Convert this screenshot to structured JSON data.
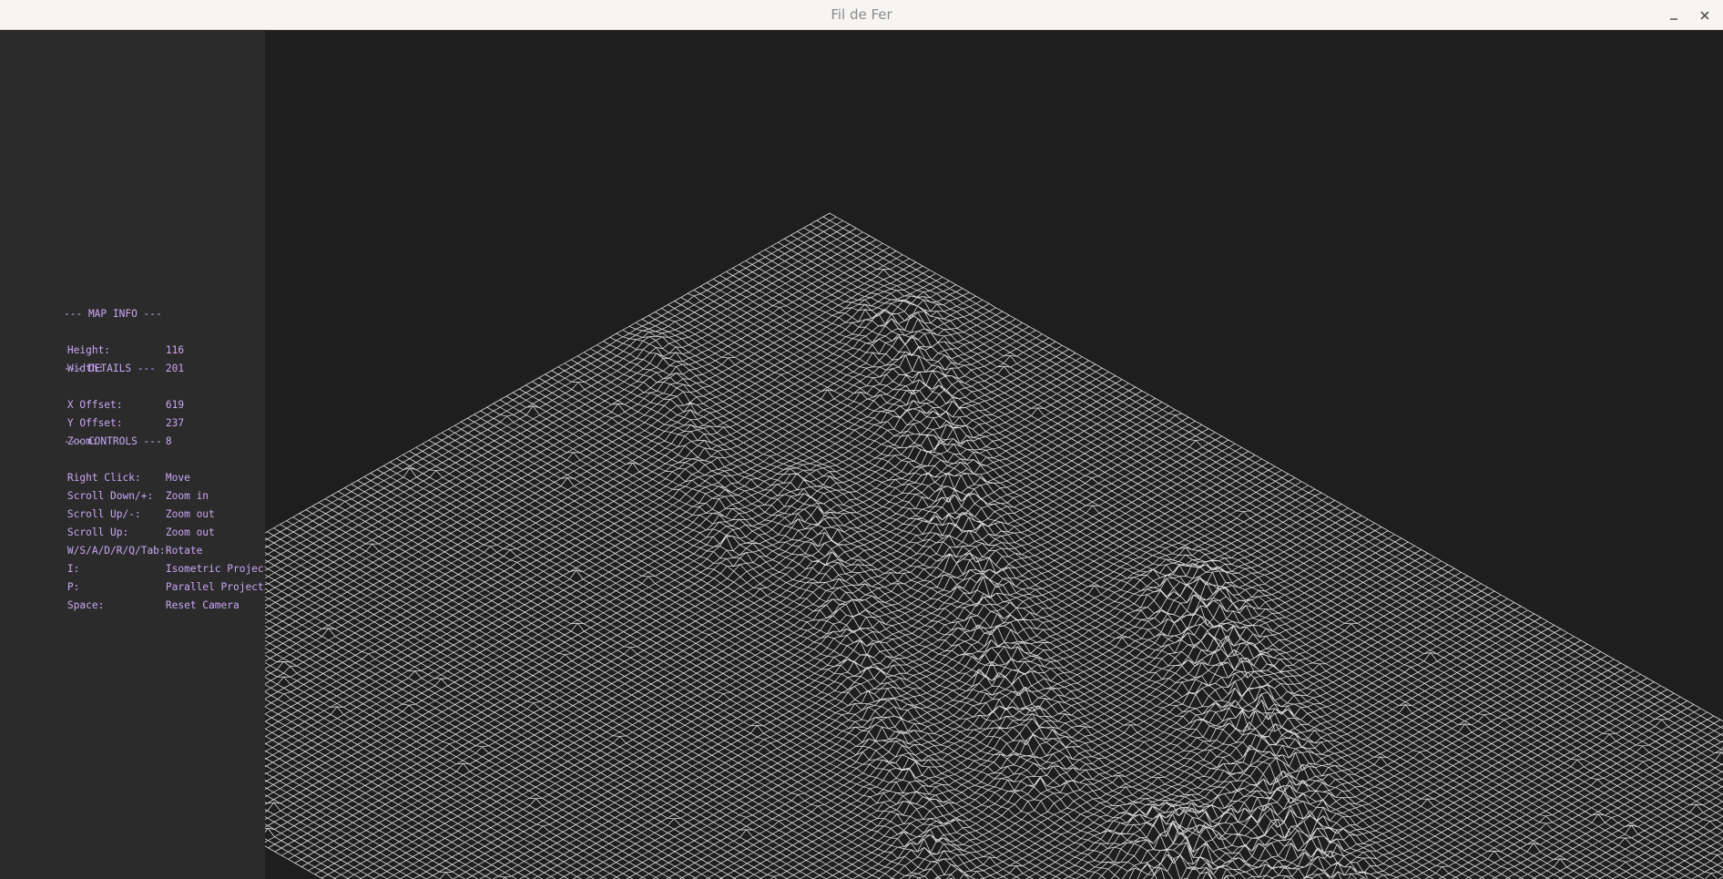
{
  "window": {
    "title": "Fil de Fer",
    "minimize_icon": "minimize-icon",
    "close_icon": "close-icon"
  },
  "info": {
    "map_info_heading": "--- MAP INFO ---",
    "height_label": "Height:",
    "height_value": "116",
    "width_label": "Width:",
    "width_value": "201",
    "details_heading": "--- DETAILS ---",
    "x_offset_label": "X Offset:",
    "x_offset_value": "619",
    "y_offset_label": "Y Offset:",
    "y_offset_value": "237",
    "zoom_label": "Zoom:",
    "zoom_value": "8",
    "controls_heading": "--- CONTROLS ---",
    "controls": [
      {
        "key": "Right Click:",
        "action": "Move"
      },
      {
        "key": "Scroll Down/+:",
        "action": "Zoom in"
      },
      {
        "key": "Scroll Up/-:",
        "action": "Zoom out"
      },
      {
        "key": "Scroll Up:",
        "action": "Zoom out"
      },
      {
        "key": "W/S/A/D/R/Q/Tab:",
        "action": "Rotate"
      },
      {
        "key": "I:",
        "action": "Isometric Projection"
      },
      {
        "key": "P:",
        "action": "Parallel Projection"
      },
      {
        "key": "Space:",
        "action": "Reset Camera"
      }
    ]
  },
  "colors": {
    "titlebar": "#f6f5f4",
    "sidebar": "#2b2b2b",
    "viewport": "#1e1e1e",
    "info_text": "#c9a7f5",
    "wireframe": "#ffffff"
  },
  "viewport": {
    "map_rows": 116,
    "map_cols": 201,
    "zoom": 8,
    "projection": "isometric"
  }
}
